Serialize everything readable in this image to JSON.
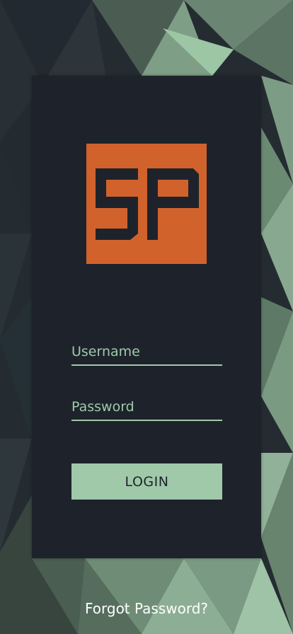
{
  "colors": {
    "background_dark": "#1e232b",
    "accent_green": "#a0c9aa",
    "logo_orange": "#d2622c",
    "text_white": "#ffffff"
  },
  "logo": {
    "text": "SP"
  },
  "form": {
    "username": {
      "placeholder": "Username",
      "value": ""
    },
    "password": {
      "placeholder": "Password",
      "value": ""
    },
    "login_label": "LOGIN"
  },
  "forgot_password": "Forgot Password?"
}
